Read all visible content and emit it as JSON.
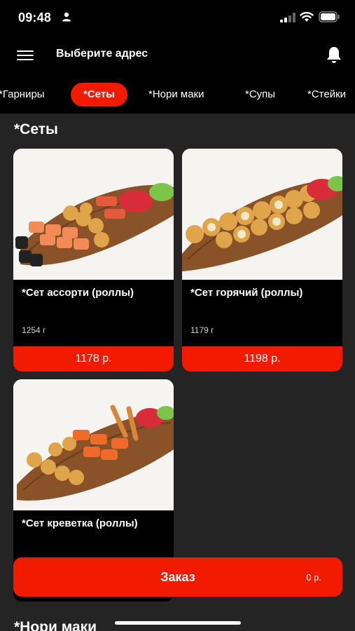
{
  "status_bar": {
    "time": "09:48",
    "icons": [
      "person-icon",
      "signal-icon",
      "wifi-icon",
      "battery-icon"
    ]
  },
  "header": {
    "title": "Выберите адрес",
    "icons": [
      "menu-icon",
      "bell-icon"
    ]
  },
  "categories": [
    {
      "label": "*Гарниры",
      "active": false
    },
    {
      "label": "*Сеты",
      "active": true
    },
    {
      "label": "*Нори маки",
      "active": false
    },
    {
      "label": "*Супы",
      "active": false
    },
    {
      "label": "*Стейки",
      "active": false
    }
  ],
  "sections": [
    {
      "title": "*Сеты",
      "products": [
        {
          "name": "*Сет ассорти (роллы)",
          "weight": "1254 г",
          "price": "1178 р."
        },
        {
          "name": "*Сет горячий (роллы)",
          "weight": "1179 г",
          "price": "1198 р."
        },
        {
          "name": "*Сет креветка (роллы)",
          "weight": "",
          "price": ""
        }
      ]
    },
    {
      "title": "*Нори маки"
    }
  ],
  "order_bar": {
    "label": "Заказ",
    "total": "0 р."
  },
  "colors": {
    "accent": "#f21a00",
    "background": "#242424",
    "bar": "#000000",
    "board": "#8a5228"
  }
}
